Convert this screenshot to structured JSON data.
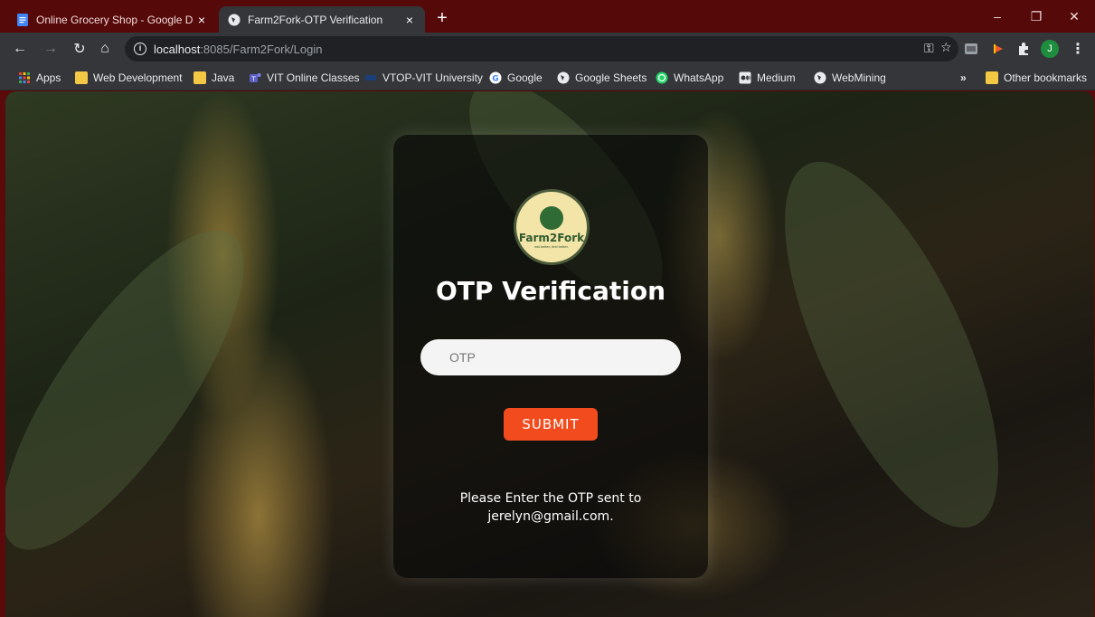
{
  "browser": {
    "tabs": [
      {
        "title": "Online Grocery Shop - Google D",
        "close": "×",
        "icon": "google-docs-icon"
      },
      {
        "title": "Farm2Fork-OTP Verification",
        "close": "×",
        "icon": "globe-icon"
      }
    ],
    "new_tab": "+",
    "window_controls": {
      "minimize": "–",
      "restore": "❐",
      "close": "✕"
    },
    "url": {
      "host": "localhost",
      "path": ":8085/Farm2Fork/Login"
    },
    "profile_initial": "J",
    "bookmarks": [
      {
        "label": "Apps",
        "icon": "apps-grid-icon"
      },
      {
        "label": "Web Development",
        "icon": "folder-icon"
      },
      {
        "label": "Java",
        "icon": "folder-icon"
      },
      {
        "label": "VIT Online Classes",
        "icon": "teams-icon"
      },
      {
        "label": "VTOP-VIT University",
        "icon": "vit-icon"
      },
      {
        "label": "Google",
        "icon": "google-icon"
      },
      {
        "label": "Google Sheets",
        "icon": "globe-icon"
      },
      {
        "label": "WhatsApp",
        "icon": "whatsapp-icon"
      },
      {
        "label": "Medium",
        "icon": "medium-icon"
      },
      {
        "label": "WebMining",
        "icon": "globe-icon"
      }
    ],
    "overflow": "»",
    "other_bookmarks": "Other bookmarks"
  },
  "page": {
    "logo": {
      "brand": "Farm2Fork",
      "tagline": "eat better, feel better."
    },
    "heading": "OTP Verification",
    "otp_placeholder": "OTP",
    "submit_label": "SUBMIT",
    "message_line1": "Please Enter the OTP sent to",
    "message_line2": "jerelyn@gmail.com."
  },
  "colors": {
    "accent": "#f24c1e",
    "titlebar": "#560909"
  }
}
